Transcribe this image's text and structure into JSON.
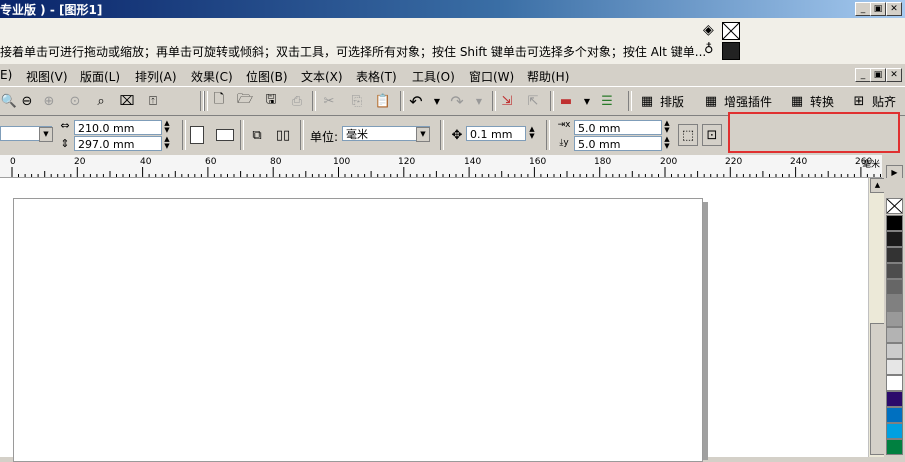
{
  "window": {
    "title": "专业版 ) - [图形1]",
    "buttons": [
      "_",
      "▣",
      "✕"
    ]
  },
  "hint": {
    "text": "接着单击可进行拖动或缩放；再单击可旋转或倾斜；双击工具，可选择所有对象；按住 Shift 键单击可选择多个对象；按住 Alt 键单..."
  },
  "menu": {
    "items": [
      "E)",
      "视图(V)",
      "版面(L)",
      "排列(A)",
      "效果(C)",
      "位图(B)",
      "文本(X)",
      "表格(T)",
      "工具(O)",
      "窗口(W)",
      "帮助(H)"
    ]
  },
  "toolbar": {
    "paiban_label": "排版",
    "zengqiang_label": "增强插件",
    "zhuanhuan_label": "转换",
    "tieqi_label": "贴齐"
  },
  "property_bar": {
    "width_value": "210.0 mm",
    "height_value": "297.0 mm",
    "unit_label": "单位:",
    "unit_value": "毫米",
    "nudge_value": "0.1 mm",
    "dup_x_value": "5.0 mm",
    "dup_y_value": "5.0 mm"
  },
  "ruler": {
    "ticks": [
      "0",
      "20",
      "40",
      "60",
      "80",
      "100",
      "120",
      "140",
      "160",
      "180",
      "200",
      "220",
      "240",
      "260"
    ],
    "unit": "毫米"
  },
  "palette": {
    "colors": [
      "#000000",
      "#1a1a1a",
      "#333333",
      "#4d4d4d",
      "#666666",
      "#808080",
      "#999999",
      "#b3b3b3",
      "#cccccc",
      "#e6e6e6",
      "#ffffff",
      "#2b0a6b",
      "#0070c0",
      "#00a0e0",
      "#008040"
    ]
  }
}
